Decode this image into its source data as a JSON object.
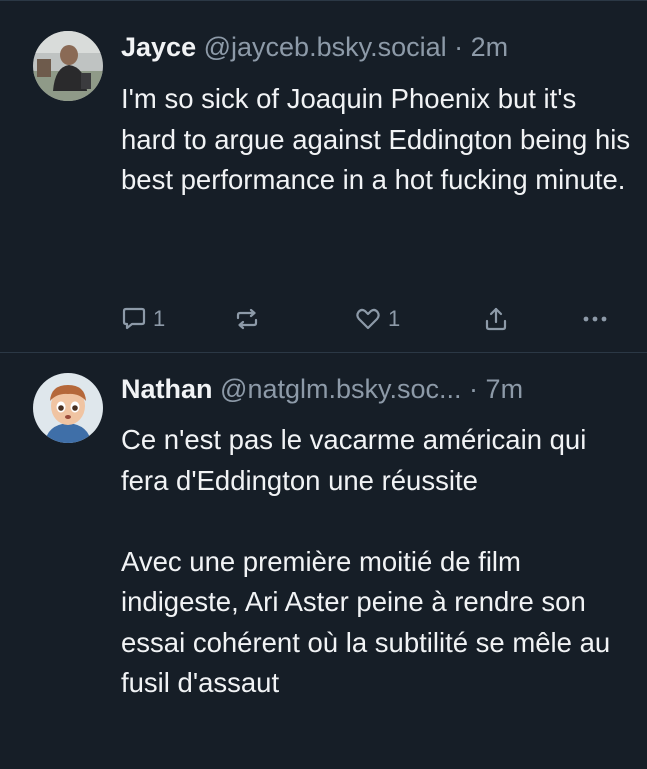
{
  "posts": [
    {
      "author": {
        "display_name": "Jayce",
        "handle": "@jayceb.bsky.social",
        "avatar": "avatar-photo-person"
      },
      "separator": "·",
      "time": "2m",
      "text": "I'm so sick of Joaquin Phoenix but it's hard to argue against Eddington being his best performance in a hot fucking minute.",
      "stats": {
        "replies": "1",
        "likes": "1"
      },
      "icons": {
        "reply": "speech-bubble-icon",
        "repost": "repost-icon",
        "like": "heart-icon",
        "share": "share-icon",
        "more": "ellipsis-icon"
      }
    },
    {
      "author": {
        "display_name": "Nathan",
        "handle": "@natglm.bsky.soc...",
        "avatar": "avatar-cartoon-boy"
      },
      "separator": "·",
      "time": "7m",
      "text": "Ce n'est pas le vacarme américain qui fera d'Eddington une réussite\n\nAvec une première moitié de film indigeste, Ari Aster peine à rendre son essai cohérent où la subtilité se mêle au fusil d'assaut"
    }
  ],
  "colors": {
    "background": "#161e27",
    "text": "#f1f3f5",
    "muted": "#8d9aa8",
    "divider": "#2b3845"
  }
}
